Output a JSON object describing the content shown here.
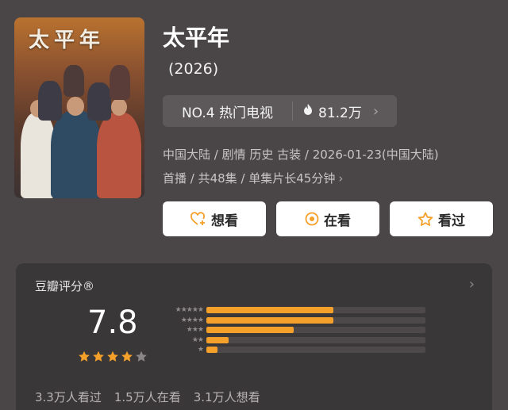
{
  "poster": {
    "title": "太平年"
  },
  "title": "太平年",
  "year": "(2026)",
  "rank": {
    "label": "NO.4 热门电视",
    "heat": "81.2万",
    "heat_icon": "flame-icon"
  },
  "meta": {
    "line1": "中国大陆 / 剧情 历史 古装 / 2026-01-23(中国大陆)",
    "line2": "首播 / 共48集 / 单集片长45分钟"
  },
  "buttons": {
    "want": "想看",
    "watching": "在看",
    "watched": "看过"
  },
  "rating": {
    "title": "豆瓣评分®",
    "score": "7.8",
    "stars_filled": 4,
    "stars_total": 5,
    "distribution": [
      {
        "stars": "★★★★★",
        "fraction": 0.58
      },
      {
        "stars": "★★★★",
        "fraction": 0.58
      },
      {
        "stars": "★★★",
        "fraction": 0.4
      },
      {
        "stars": "★★",
        "fraction": 0.1
      },
      {
        "stars": "★",
        "fraction": 0.05
      }
    ],
    "counts": [
      "3.3万人看过",
      "1.5万人在看",
      "3.1万人想看"
    ]
  },
  "colors": {
    "accent": "#f5a02a",
    "background": "#4a4547",
    "card": "#3a3738"
  }
}
